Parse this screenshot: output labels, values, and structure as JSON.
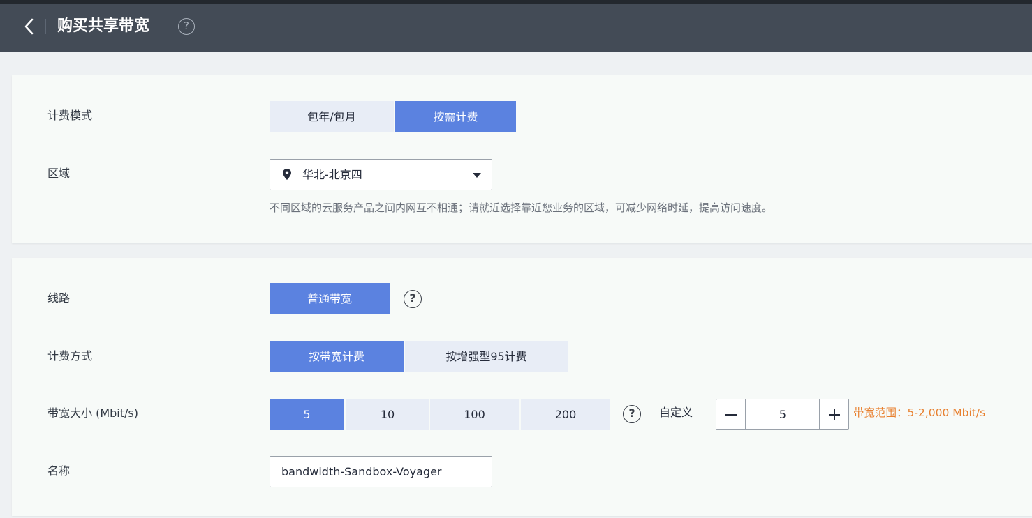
{
  "header": {
    "title": "购买共享带宽",
    "help_symbol": "?"
  },
  "billing_mode": {
    "label": "计费模式",
    "options": [
      "包年/包月",
      "按需计费"
    ],
    "selected": "按需计费"
  },
  "region": {
    "label": "区域",
    "value": "华北-北京四",
    "hint": "不同区域的云服务产品之间内网互不相通；请就近选择靠近您业务的区域，可减少网络时延，提高访问速度。"
  },
  "line": {
    "label": "线路",
    "options": [
      "普通带宽"
    ],
    "selected": "普通带宽",
    "help_symbol": "?"
  },
  "billing_method": {
    "label": "计费方式",
    "options": [
      "按带宽计费",
      "按增强型95计费"
    ],
    "selected": "按带宽计费"
  },
  "bandwidth": {
    "label": "带宽大小 (Mbit/s)",
    "options": [
      "5",
      "10",
      "100",
      "200"
    ],
    "selected": "5",
    "help_symbol": "?",
    "custom_label": "自定义",
    "custom_value": "5",
    "range_hint": "带宽范围：5-2,000 Mbit/s"
  },
  "name": {
    "label": "名称",
    "value": "bandwidth-Sandbox-Voyager"
  },
  "colors": {
    "header_bg": "#434b56",
    "accent": "#5b82e0",
    "warning_text": "#e8802f"
  },
  "icons": {
    "back": "chevron-left-icon",
    "location": "map-pin-icon",
    "dropdown": "caret-down-icon",
    "help": "question-circle-icon",
    "minus": "minus-icon",
    "plus": "plus-icon"
  }
}
